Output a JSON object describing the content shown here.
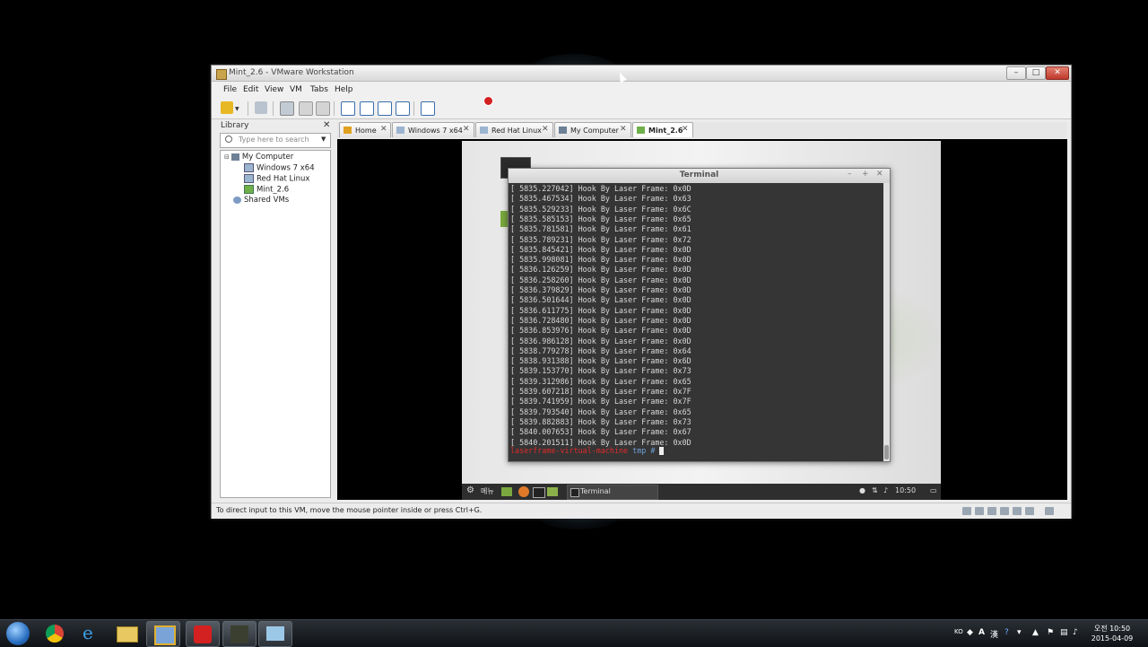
{
  "window": {
    "title": "Mint_2.6 - VMware Workstation",
    "controls": {
      "minimize": "–",
      "maximize": "□",
      "close": "✕"
    }
  },
  "menu": [
    "File",
    "Edit",
    "View",
    "VM",
    "Tabs",
    "Help"
  ],
  "library": {
    "title": "Library",
    "close": "✕",
    "search_placeholder": "Type here to search",
    "tree": [
      "My Computer",
      "Windows 7 x64",
      "Red Hat Linux",
      "Mint_2.6",
      "Shared VMs"
    ]
  },
  "tabs": [
    {
      "label": "Home",
      "active": false
    },
    {
      "label": "Windows 7 x64",
      "active": false
    },
    {
      "label": "Red Hat Linux",
      "active": false
    },
    {
      "label": "My Computer",
      "active": false
    },
    {
      "label": "Mint_2.6",
      "active": true
    }
  ],
  "terminal": {
    "title": "Terminal",
    "controls": {
      "minimize": "–",
      "maximize": "+",
      "close": "✕"
    },
    "lines": [
      "[ 5835.227042] Hook By Laser Frame: 0x0D",
      "[ 5835.467534] Hook By Laser Frame: 0x63",
      "[ 5835.529233] Hook By Laser Frame: 0x6C",
      "[ 5835.585153] Hook By Laser Frame: 0x65",
      "[ 5835.781581] Hook By Laser Frame: 0x61",
      "[ 5835.789231] Hook By Laser Frame: 0x72",
      "[ 5835.845421] Hook By Laser Frame: 0x0D",
      "[ 5835.998081] Hook By Laser Frame: 0x0D",
      "[ 5836.126259] Hook By Laser Frame: 0x0D",
      "[ 5836.258260] Hook By Laser Frame: 0x0D",
      "[ 5836.379829] Hook By Laser Frame: 0x0D",
      "[ 5836.501644] Hook By Laser Frame: 0x0D",
      "[ 5836.611775] Hook By Laser Frame: 0x0D",
      "[ 5836.728480] Hook By Laser Frame: 0x0D",
      "[ 5836.853976] Hook By Laser Frame: 0x0D",
      "[ 5836.986128] Hook By Laser Frame: 0x0D",
      "[ 5838.779278] Hook By Laser Frame: 0x64",
      "[ 5838.931388] Hook By Laser Frame: 0x6D",
      "[ 5839.153770] Hook By Laser Frame: 0x73",
      "[ 5839.312986] Hook By Laser Frame: 0x65",
      "[ 5839.607218] Hook By Laser Frame: 0x7F",
      "[ 5839.741959] Hook By Laser Frame: 0x7F",
      "[ 5839.793540] Hook By Laser Frame: 0x65",
      "[ 5839.882883] Hook By Laser Frame: 0x73",
      "[ 5840.007653] Hook By Laser Frame: 0x67",
      "[ 5840.201511] Hook By Laser Frame: 0x0D"
    ],
    "prompt_user": "laserframe-virtual-machine",
    "prompt_dir": "tmp",
    "prompt_symbol": "#"
  },
  "guest_panel": {
    "lang": "메뉴",
    "task_label": "Terminal",
    "clock": "10:50"
  },
  "status": {
    "text": "To direct input to this VM, move the mouse pointer inside or press Ctrl+G."
  },
  "taskbar": {
    "clock_ampm": "오전 10:50",
    "date": "2015-04-09",
    "lang": "KO",
    "ime_a": "A",
    "ime_han": "漢"
  },
  "colors": {
    "prompt_user": "#e02a2a",
    "prompt_dir": "#6f9fd8",
    "terminal_bg": "#353535",
    "record": "#d32020"
  }
}
